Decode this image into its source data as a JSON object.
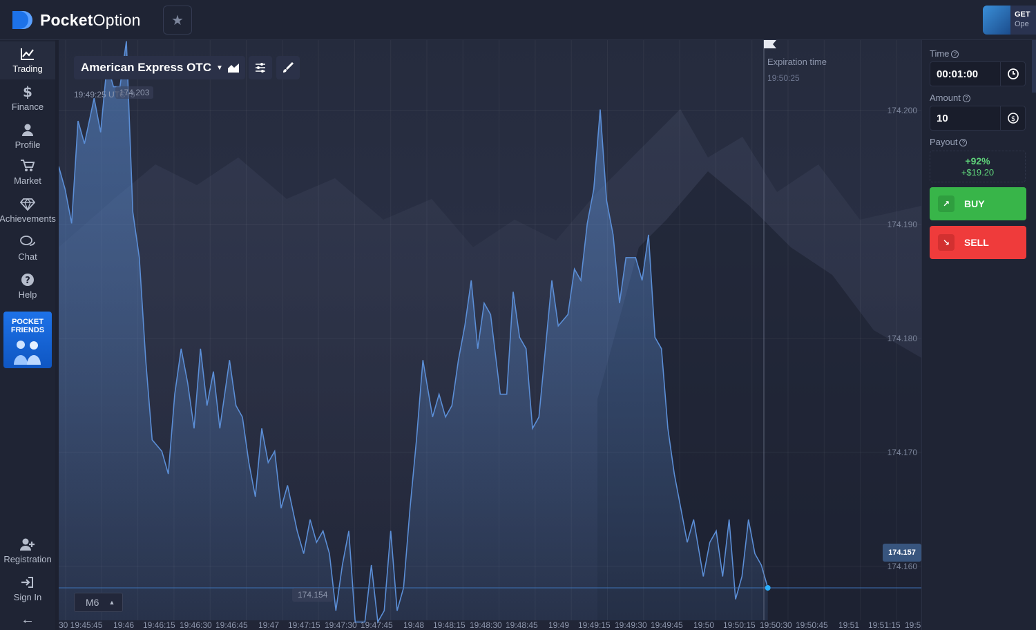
{
  "brand": {
    "name_bold": "Pocket",
    "name_light": "Option"
  },
  "promo": {
    "title": "GET",
    "subtitle": "Ope"
  },
  "sidebar": {
    "items": [
      {
        "label": "Trading"
      },
      {
        "label": "Finance"
      },
      {
        "label": "Profile"
      },
      {
        "label": "Market"
      },
      {
        "label": "Achievements"
      },
      {
        "label": "Chat"
      },
      {
        "label": "Help"
      }
    ],
    "pocket_friends_line1": "POCKET",
    "pocket_friends_line2": "FRIENDS",
    "registration": "Registration",
    "sign_in": "Sign In",
    "back": "←"
  },
  "chart": {
    "asset": "American Express OTC",
    "server_time": "19:49:25 UTC+3",
    "high_label": "174.203",
    "low_label": "174.154",
    "expiration_label": "Expiration time",
    "expiration_time": "19:50:25",
    "current_price": "174.157",
    "timeframe": "M6",
    "y_labels": [
      "174.200",
      "174.190",
      "174.180",
      "174.170",
      "174.160"
    ],
    "x_labels": [
      "30 19:45:45",
      "19:46",
      "19:46:15",
      "19:46:30",
      "19:46:45",
      "19:47",
      "19:47:15",
      "19:47:30",
      "19:47:45",
      "19:48",
      "19:48:15",
      "19:48:30",
      "19:48:45",
      "19:49",
      "19:49:15",
      "19:49:30",
      "19:49:45",
      "19:50",
      "19:50:15",
      "19:50:30",
      "19:50:45",
      "19:51",
      "19:51:15",
      "19:5"
    ]
  },
  "panel": {
    "time_label": "Time",
    "time_value": "00:01:00",
    "amount_label": "Amount",
    "amount_value": "10",
    "payout_label": "Payout",
    "payout_pct": "+92%",
    "payout_amount": "+$19.20",
    "buy_label": "BUY",
    "sell_label": "SELL"
  },
  "colors": {
    "buy": "#38b549",
    "sell": "#ef3b3b",
    "line": "#5b8ed6",
    "accent": "#1d72e8"
  },
  "chart_data": {
    "type": "area",
    "title": "",
    "xlabel": "",
    "ylabel": "",
    "ylim": [
      174.1533,
      174.2051
    ],
    "grid": true,
    "x": [
      "19:45:41",
      "19:45:43",
      "19:45:45",
      "19:45:47",
      "19:45:49",
      "19:45:51",
      "19:45:53",
      "19:45:56",
      "19:45:58",
      "19:46:00",
      "19:46:02",
      "19:46:04",
      "19:46:06",
      "19:46:08",
      "19:46:10",
      "19:46:12",
      "19:46:14",
      "19:46:17",
      "19:46:19",
      "19:46:21",
      "19:46:23",
      "19:46:25",
      "19:46:27",
      "19:46:29",
      "19:46:31",
      "19:46:33",
      "19:46:35",
      "19:46:38",
      "19:46:40",
      "19:46:42",
      "19:46:44",
      "19:46:46",
      "19:46:48",
      "19:46:50",
      "19:46:52",
      "19:46:54",
      "19:46:56",
      "19:46:59",
      "19:47:01",
      "19:47:03",
      "19:47:05",
      "19:47:07",
      "19:47:09",
      "19:47:11",
      "19:47:13",
      "19:47:15",
      "19:47:17",
      "19:47:20",
      "19:47:22",
      "19:47:24",
      "19:47:26",
      "19:47:28",
      "19:47:30",
      "19:47:32",
      "19:47:34",
      "19:47:36",
      "19:47:38",
      "19:47:41",
      "19:47:43",
      "19:47:45",
      "19:47:47",
      "19:47:49",
      "19:47:51",
      "19:47:53",
      "19:47:55",
      "19:47:57",
      "19:47:59",
      "19:48:02",
      "19:48:04",
      "19:48:06",
      "19:48:08",
      "19:48:10",
      "19:48:12",
      "19:48:14",
      "19:48:16",
      "19:48:18",
      "19:48:20",
      "19:48:23",
      "19:48:25",
      "19:48:27",
      "19:48:29",
      "19:48:31",
      "19:48:33",
      "19:48:35",
      "19:48:37",
      "19:48:39",
      "19:48:41",
      "19:48:44",
      "19:48:46",
      "19:48:48",
      "19:48:50",
      "19:48:52",
      "19:48:54",
      "19:48:56",
      "19:48:58",
      "19:49:00",
      "19:49:02",
      "19:49:05",
      "19:49:07",
      "19:49:09",
      "19:49:11",
      "19:49:13",
      "19:49:15",
      "19:49:17",
      "19:49:19",
      "19:49:21",
      "19:49:23",
      "19:49:25"
    ],
    "series": [
      {
        "values": [
          174.1941,
          174.1906,
          174.194,
          174.192,
          174.189,
          174.198,
          174.196,
          174.2,
          174.197,
          174.203,
          174.201,
          174.201,
          174.205,
          174.19,
          174.186,
          174.177,
          174.17,
          174.169,
          174.167,
          174.174,
          174.178,
          174.175,
          174.171,
          174.178,
          174.173,
          174.176,
          174.171,
          174.177,
          174.173,
          174.172,
          174.168,
          174.165,
          174.171,
          174.168,
          174.169,
          174.164,
          174.166,
          174.162,
          174.16,
          174.163,
          174.161,
          174.162,
          174.16,
          174.155,
          174.159,
          174.162,
          174.154,
          174.154,
          174.159,
          174.154,
          174.155,
          174.162,
          174.155,
          174.157,
          174.164,
          174.17,
          174.177,
          174.172,
          174.174,
          174.172,
          174.173,
          174.177,
          174.18,
          174.184,
          174.178,
          174.182,
          174.181,
          174.174,
          174.174,
          174.183,
          174.179,
          174.178,
          174.171,
          174.172,
          174.178,
          174.184,
          174.18,
          174.181,
          174.185,
          174.184,
          174.189,
          174.192,
          174.199,
          174.191,
          174.188,
          174.182,
          174.186,
          174.186,
          174.184,
          174.188,
          174.179,
          174.178,
          174.171,
          174.167,
          174.164,
          174.161,
          174.163,
          174.158,
          174.161,
          174.162,
          174.158,
          174.163,
          174.156,
          174.158,
          174.163,
          174.16,
          174.159,
          174.157
        ]
      }
    ]
  }
}
